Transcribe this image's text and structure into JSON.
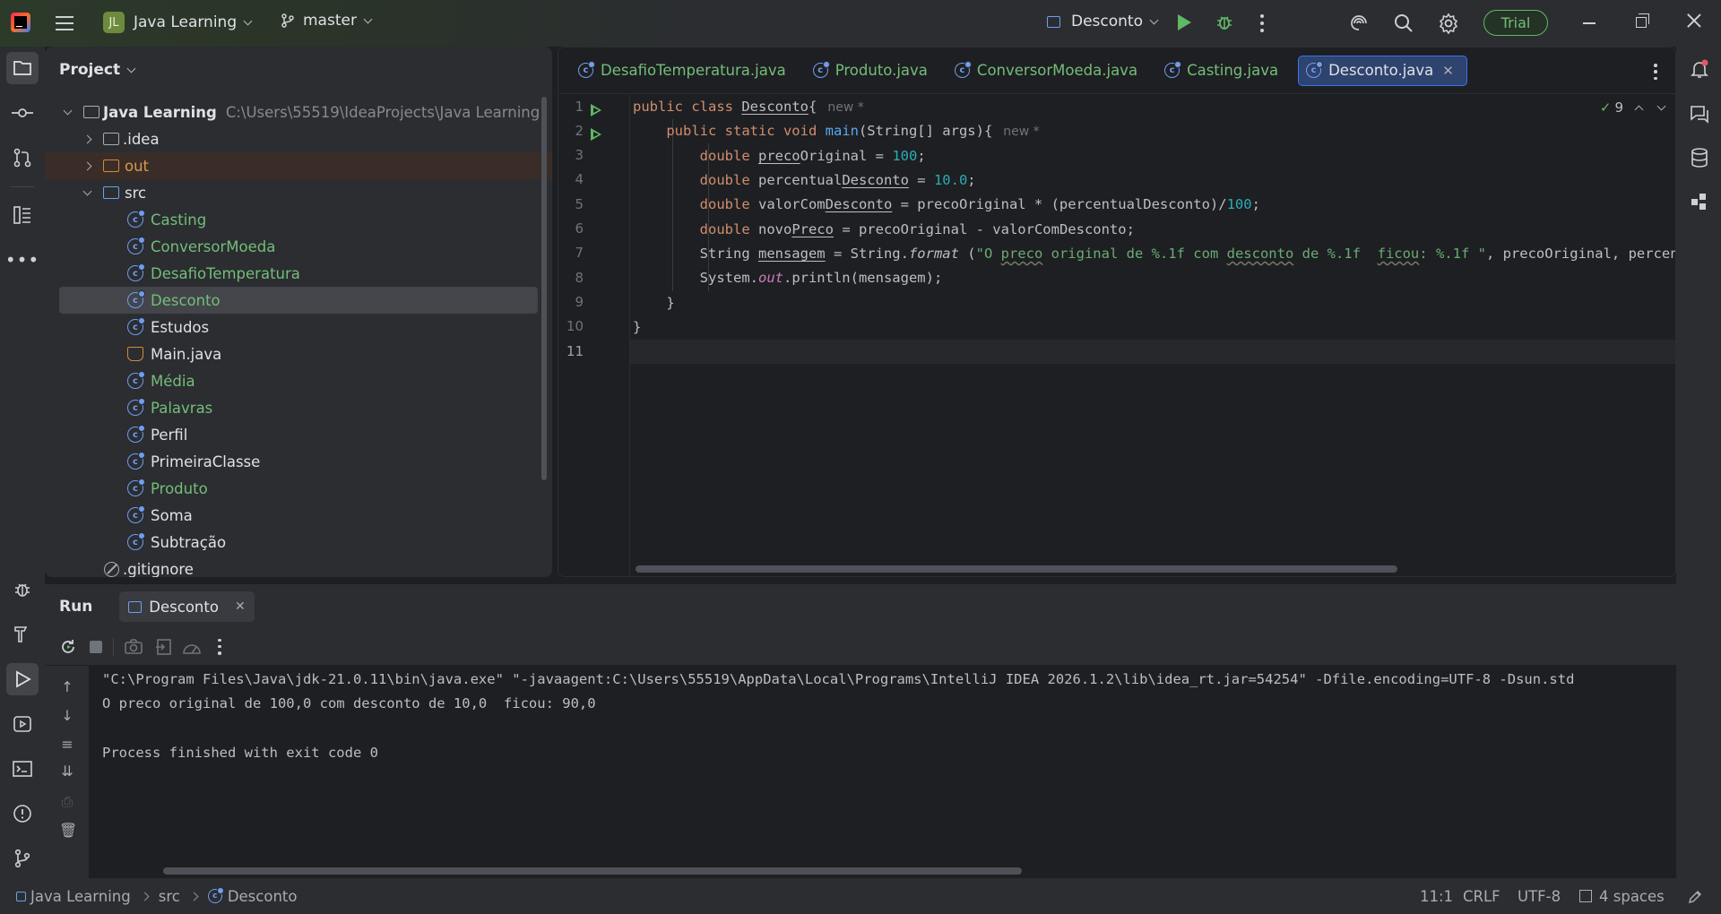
{
  "titlebar": {
    "project_initials": "JL",
    "project_name": "Java Learning",
    "branch": "master",
    "run_config": "Desconto",
    "trial_label": "Trial"
  },
  "project_panel": {
    "title": "Project",
    "root_name": "Java Learning",
    "root_path": "C:\\Users\\55519\\IdeaProjects\\Java Learning",
    "items": [
      {
        "label": ".idea",
        "type": "folder"
      },
      {
        "label": "out",
        "type": "folder-excluded"
      },
      {
        "label": "src",
        "type": "folder-source"
      },
      {
        "label": "Casting",
        "type": "class",
        "modified": true
      },
      {
        "label": "ConversorMoeda",
        "type": "class",
        "modified": true
      },
      {
        "label": "DesafioTemperatura",
        "type": "class",
        "modified": true
      },
      {
        "label": "Desconto",
        "type": "class",
        "modified": true,
        "selected": true
      },
      {
        "label": "Estudos",
        "type": "class",
        "modified": false
      },
      {
        "label": "Main.java",
        "type": "java-file",
        "modified": false
      },
      {
        "label": "Média",
        "type": "class",
        "modified": true
      },
      {
        "label": "Palavras",
        "type": "class",
        "modified": true
      },
      {
        "label": "Perfil",
        "type": "class",
        "modified": false
      },
      {
        "label": "PrimeiraClasse",
        "type": "class",
        "modified": false
      },
      {
        "label": "Produto",
        "type": "class",
        "modified": true
      },
      {
        "label": "Soma",
        "type": "class",
        "modified": false
      },
      {
        "label": "Subtração",
        "type": "class",
        "modified": false
      },
      {
        "label": ".gitignore",
        "type": "ignore-file",
        "modified": false
      }
    ]
  },
  "editor": {
    "tabs": [
      {
        "label": "DesafioTemperatura.java",
        "active": false
      },
      {
        "label": "Produto.java",
        "active": false
      },
      {
        "label": "ConversorMoeda.java",
        "active": false
      },
      {
        "label": "Casting.java",
        "active": false
      },
      {
        "label": "Desconto.java",
        "active": true
      }
    ],
    "inspection_count": "9",
    "hint_new": "new *",
    "line_numbers": [
      "1",
      "2",
      "3",
      "4",
      "5",
      "6",
      "7",
      "8",
      "9",
      "10",
      "11"
    ],
    "current_line": 11
  },
  "run_panel": {
    "title": "Run",
    "tab_label": "Desconto",
    "console_lines": [
      "\"C:\\Program Files\\Java\\jdk-21.0.11\\bin\\java.exe\" \"-javaagent:C:\\Users\\55519\\AppData\\Local\\Programs\\IntelliJ IDEA 2026.1.2\\lib\\idea_rt.jar=54254\" -Dfile.encoding=UTF-8 -Dsun.std",
      "O preco original de 100,0 com desconto de 10,0  ficou: 90,0",
      "",
      "Process finished with exit code 0"
    ]
  },
  "statusbar": {
    "breadcrumb": [
      "Java Learning",
      "src",
      "Desconto"
    ],
    "position": "11:1",
    "line_sep": "CRLF",
    "encoding": "UTF-8",
    "indent": "4 spaces"
  },
  "colors": {
    "accent": "#3574f0",
    "modified_green": "#73bd79",
    "keyword": "#cf8e6d",
    "number": "#2aacb8",
    "string": "#6aab73"
  }
}
